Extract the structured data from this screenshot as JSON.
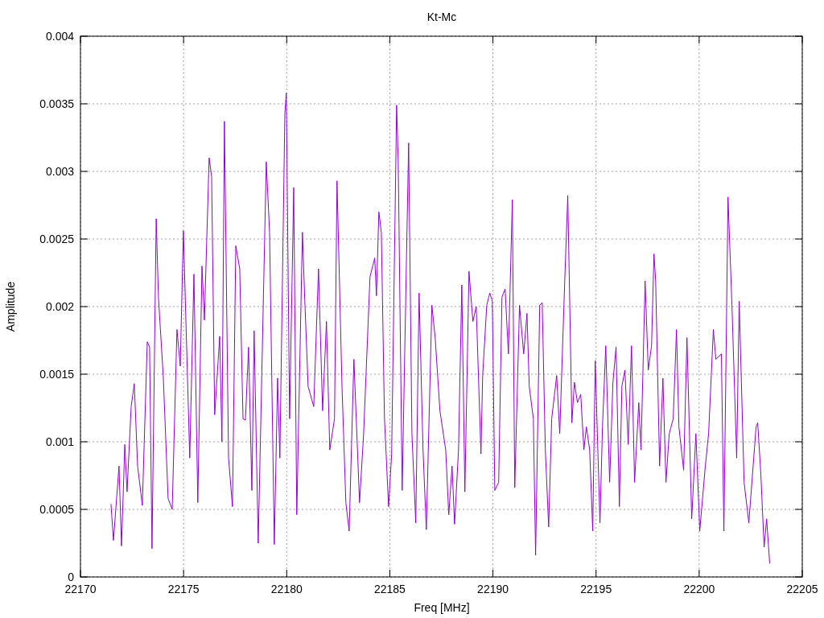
{
  "chart": {
    "chart_data": {
      "type": "line",
      "title": "Kt-Mc",
      "xlabel": "Freq [MHz]",
      "ylabel": "Amplitude",
      "grid": true,
      "xlim": [
        22170,
        22205
      ],
      "ylim": [
        0,
        0.004
      ],
      "xticks": [
        22170,
        22175,
        22180,
        22185,
        22190,
        22195,
        22200,
        22205
      ],
      "yticks": [
        0,
        0.0005,
        0.001,
        0.0015,
        0.002,
        0.0025,
        0.003,
        0.0035,
        0.004
      ],
      "x": [
        22171.48,
        22171.6,
        22171.87,
        22171.99,
        22172.15,
        22172.26,
        22172.46,
        22172.61,
        22172.77,
        22173,
        22173.24,
        22173.35,
        22173.47,
        22173.67,
        22173.78,
        22174.02,
        22174.25,
        22174.45,
        22174.68,
        22174.84,
        22174.99,
        22175.3,
        22175.5,
        22175.69,
        22175.89,
        22176.01,
        22176.24,
        22176.36,
        22176.51,
        22176.75,
        22176.86,
        22176.98,
        22177.18,
        22177.37,
        22177.53,
        22177.72,
        22177.88,
        22178,
        22178.15,
        22178.31,
        22178.42,
        22178.62,
        22179.01,
        22179.17,
        22179.4,
        22179.56,
        22179.67,
        22179.91,
        22179.98,
        22180.14,
        22180.34,
        22180.49,
        22180.76,
        22180.88,
        22181.04,
        22181.31,
        22181.54,
        22181.74,
        22181.93,
        22182.09,
        22182.32,
        22182.44,
        22182.68,
        22182.87,
        22183.03,
        22183.26,
        22183.53,
        22183.73,
        22184.04,
        22184.27,
        22184.35,
        22184.47,
        22184.59,
        22184.74,
        22184.94,
        22185.09,
        22185.33,
        22185.41,
        22185.6,
        22185.91,
        22186.07,
        22186.26,
        22186.42,
        22186.61,
        22186.77,
        22187.04,
        22187.2,
        22187.43,
        22187.71,
        22187.86,
        22188.02,
        22188.14,
        22188.33,
        22188.49,
        22188.64,
        22188.84,
        22189.03,
        22189.19,
        22189.42,
        22189.5,
        22189.7,
        22189.85,
        22189.97,
        22190.09,
        22190.28,
        22190.44,
        22190.59,
        22190.75,
        22190.94,
        22191.06,
        22191.29,
        22191.49,
        22191.65,
        22191.76,
        22191.96,
        22192.07,
        22192.27,
        22192.39,
        22192.54,
        22192.7,
        22192.85,
        22193.09,
        22193.24,
        22193.48,
        22193.63,
        22193.83,
        22193.95,
        22194.1,
        22194.26,
        22194.41,
        22194.53,
        22194.69,
        22194.84,
        22194.96,
        22195.19,
        22195.31,
        22195.47,
        22195.66,
        22195.82,
        22195.97,
        22196.13,
        22196.25,
        22196.4,
        22196.56,
        22196.72,
        22196.87,
        22197.07,
        22197.18,
        22197.38,
        22197.53,
        22197.69,
        22197.81,
        22197.89,
        22198.08,
        22198.24,
        22198.39,
        22198.55,
        22198.74,
        22198.9,
        22199.02,
        22199.25,
        22199.41,
        22199.64,
        22199.84,
        22200.03,
        22200.3,
        22200.46,
        22200.69,
        22200.81,
        22201.08,
        22201.2,
        22201.4,
        22201.59,
        22201.82,
        22201.94,
        22202.18,
        22202.41,
        22202.76,
        22202.84,
        22202.99,
        22203.15,
        22203.27,
        22203.42
      ],
      "values": [
        0.00054,
        0.00027,
        0.00082,
        0.00023,
        0.00098,
        0.00063,
        0.00126,
        0.00143,
        0.00082,
        0.00053,
        0.00174,
        0.0017,
        0.00021,
        0.00265,
        0.00207,
        0.00147,
        0.00058,
        0.0005,
        0.00183,
        0.00156,
        0.00256,
        0.00088,
        0.00224,
        0.00055,
        0.0023,
        0.0019,
        0.0031,
        0.00296,
        0.0012,
        0.00178,
        0.001,
        0.00337,
        0.00088,
        0.00052,
        0.00245,
        0.00228,
        0.00117,
        0.00116,
        0.0017,
        0.00064,
        0.00182,
        0.00025,
        0.00307,
        0.00255,
        0.00024,
        0.00147,
        0.00088,
        0.00343,
        0.00358,
        0.00117,
        0.00288,
        0.00046,
        0.00255,
        0.00204,
        0.00141,
        0.00126,
        0.00228,
        0.00123,
        0.00189,
        0.00094,
        0.00117,
        0.00293,
        0.00141,
        0.00055,
        0.00034,
        0.00161,
        0.00055,
        0.00106,
        0.00222,
        0.00236,
        0.00208,
        0.0027,
        0.00255,
        0.00117,
        0.00052,
        0.00091,
        0.00349,
        0.00307,
        0.00064,
        0.00321,
        0.00106,
        0.0004,
        0.0021,
        0.00094,
        0.00035,
        0.00201,
        0.00177,
        0.00123,
        0.00094,
        0.00046,
        0.00082,
        0.00039,
        0.00094,
        0.00216,
        0.00063,
        0.00226,
        0.00189,
        0.002,
        0.00091,
        0.00149,
        0.00201,
        0.0021,
        0.00204,
        0.00064,
        0.0007,
        0.00207,
        0.00213,
        0.00165,
        0.00279,
        0.00066,
        0.00201,
        0.00165,
        0.00195,
        0.00141,
        0.00117,
        0.00016,
        0.00201,
        0.00203,
        0.00094,
        0.00037,
        0.00117,
        0.00149,
        0.00106,
        0.00219,
        0.00282,
        0.00114,
        0.00144,
        0.00129,
        0.00135,
        0.00094,
        0.00111,
        0.00094,
        0.00034,
        0.0016,
        0.0004,
        0.00111,
        0.00171,
        0.0007,
        0.00144,
        0.0017,
        0.00052,
        0.00141,
        0.00153,
        0.00098,
        0.00171,
        0.0007,
        0.00129,
        0.00094,
        0.00219,
        0.00153,
        0.00171,
        0.00239,
        0.00219,
        0.00082,
        0.00147,
        0.0007,
        0.00106,
        0.00117,
        0.00183,
        0.00111,
        0.00079,
        0.00177,
        0.00043,
        0.00106,
        0.00034,
        0.00082,
        0.00106,
        0.00183,
        0.00161,
        0.00165,
        0.00034,
        0.00281,
        0.00201,
        0.00088,
        0.00204,
        0.0007,
        0.0004,
        0.00111,
        0.00114,
        0.00076,
        0.00022,
        0.00043,
        0.0001
      ]
    }
  }
}
